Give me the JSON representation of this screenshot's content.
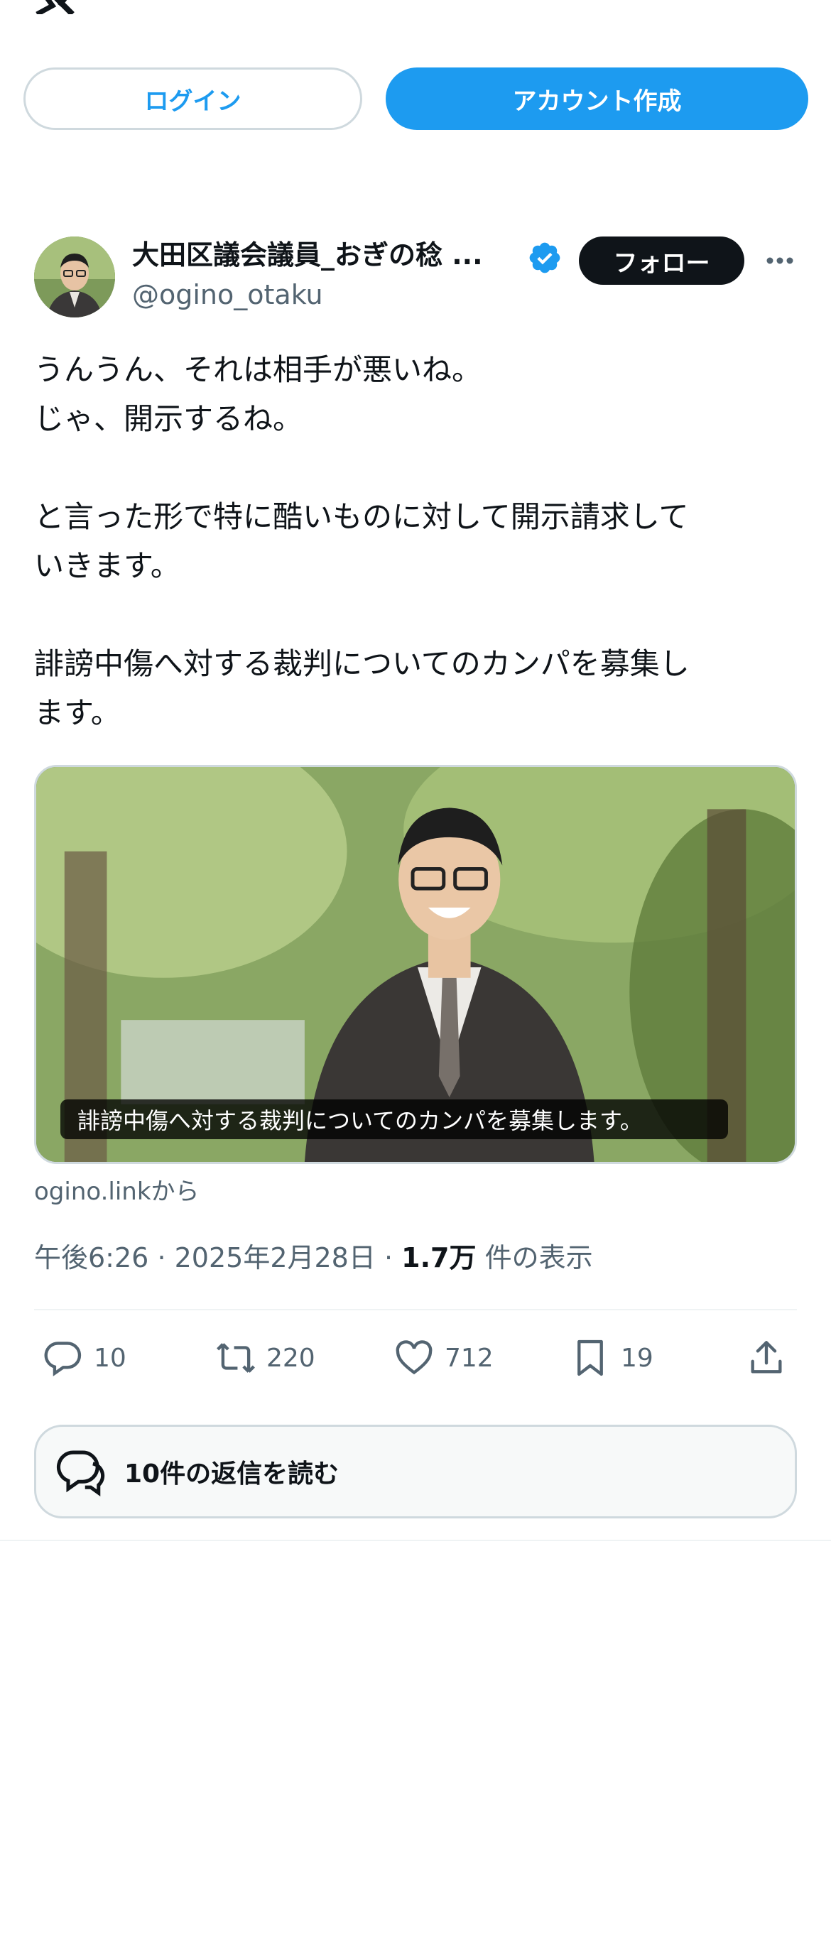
{
  "header": {
    "logo_icon": "x-logo-icon"
  },
  "auth": {
    "login_label": "ログイン",
    "signup_label": "アカウント作成"
  },
  "tweet": {
    "author": {
      "display_name": "大田区議会議員_おぎの稔 ...",
      "handle": "@ogino_otaku",
      "verified": true,
      "follow_label": "フォロー"
    },
    "text": "うんうん、それは相手が悪いね。\nじゃ、開示するね。\n\nと言った形で特に酷いものに対して開示請求して\nいきます。\n\n誹謗中傷へ対する裁判についてのカンパを募集し\nます。",
    "card": {
      "caption": "誹謗中傷へ対する裁判についてのカンパを募集します。",
      "source": "ogino.linkから"
    },
    "meta": {
      "time": "午後6:26",
      "separator": "·",
      "date": "2025年2月28日",
      "views": "1.7万",
      "views_label": "件の表示"
    },
    "actions": {
      "replies": "10",
      "retweets": "220",
      "likes": "712",
      "bookmarks": "19"
    },
    "read_replies_label": "10件の返信を読む"
  },
  "colors": {
    "accent": "#1d9bf0",
    "text_primary": "#0f1419",
    "text_secondary": "#536471",
    "border": "#cfd9de"
  }
}
